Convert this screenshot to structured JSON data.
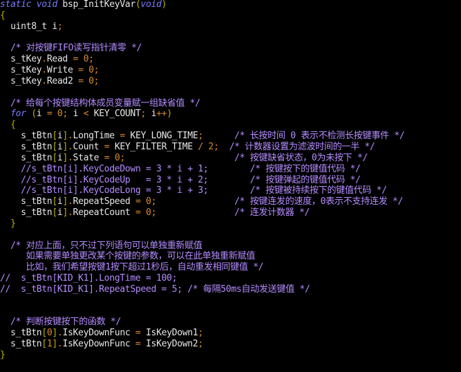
{
  "theme": {
    "background": "#000000",
    "plain": "#e8e8e8",
    "keyword": "#7a7aff",
    "comment": "#b48cff",
    "number": "#d98a2c",
    "operator": "#d98a2c",
    "bracket": "#b9b200",
    "paren": "#b9b200"
  },
  "lines": [
    [
      [
        "keyword",
        "static void "
      ],
      [
        "plain",
        "bsp_InitKeyVar"
      ],
      [
        "paren",
        "("
      ],
      [
        "keyword",
        "void"
      ],
      [
        "paren",
        ")"
      ]
    ],
    [
      [
        "paren",
        "{"
      ]
    ],
    [
      [
        "plain",
        "  uint8_t i"
      ],
      [
        "operator",
        ";"
      ]
    ],
    [],
    [
      [
        "comment",
        "  /* 对按键FIFO读写指针清零 */"
      ]
    ],
    [
      [
        "plain",
        "  s_tKey"
      ],
      [
        "operator",
        "."
      ],
      [
        "plain",
        "Read "
      ],
      [
        "operator",
        "= "
      ],
      [
        "number",
        "0"
      ],
      [
        "operator",
        ";"
      ]
    ],
    [
      [
        "plain",
        "  s_tKey"
      ],
      [
        "operator",
        "."
      ],
      [
        "plain",
        "Write "
      ],
      [
        "operator",
        "= "
      ],
      [
        "number",
        "0"
      ],
      [
        "operator",
        ";"
      ]
    ],
    [
      [
        "plain",
        "  s_tKey"
      ],
      [
        "operator",
        "."
      ],
      [
        "plain",
        "Read2 "
      ],
      [
        "operator",
        "= "
      ],
      [
        "number",
        "0"
      ],
      [
        "operator",
        ";"
      ]
    ],
    [],
    [
      [
        "comment",
        "  /* 给每个按键结构体成员变量赋一组缺省值 */"
      ]
    ],
    [
      [
        "keyword",
        "  for "
      ],
      [
        "paren",
        "("
      ],
      [
        "plain",
        "i "
      ],
      [
        "operator",
        "= "
      ],
      [
        "number",
        "0"
      ],
      [
        "operator",
        "; "
      ],
      [
        "plain",
        "i "
      ],
      [
        "operator",
        "< "
      ],
      [
        "plain",
        "KEY_COUNT"
      ],
      [
        "operator",
        "; "
      ],
      [
        "plain",
        "i"
      ],
      [
        "operator",
        "++"
      ],
      [
        "paren",
        ")"
      ]
    ],
    [
      [
        "paren",
        "  {"
      ]
    ],
    [
      [
        "plain",
        "    s_tBtn"
      ],
      [
        "bracket",
        "["
      ],
      [
        "plain",
        "i"
      ],
      [
        "bracket",
        "]"
      ],
      [
        "operator",
        "."
      ],
      [
        "plain",
        "LongTime "
      ],
      [
        "operator",
        "= "
      ],
      [
        "plain",
        "KEY_LONG_TIME"
      ],
      [
        "operator",
        ";      "
      ],
      [
        "comment",
        "/* 长按时间 0 表示不检测长按键事件 */"
      ]
    ],
    [
      [
        "plain",
        "    s_tBtn"
      ],
      [
        "bracket",
        "["
      ],
      [
        "plain",
        "i"
      ],
      [
        "bracket",
        "]"
      ],
      [
        "operator",
        "."
      ],
      [
        "plain",
        "Count "
      ],
      [
        "operator",
        "= "
      ],
      [
        "plain",
        "KEY_FILTER_TIME "
      ],
      [
        "operator",
        "/ "
      ],
      [
        "number",
        "2"
      ],
      [
        "operator",
        ";  "
      ],
      [
        "comment",
        "/* 计数器设置为滤波时间的一半 */"
      ]
    ],
    [
      [
        "plain",
        "    s_tBtn"
      ],
      [
        "bracket",
        "["
      ],
      [
        "plain",
        "i"
      ],
      [
        "bracket",
        "]"
      ],
      [
        "operator",
        "."
      ],
      [
        "plain",
        "State "
      ],
      [
        "operator",
        "= "
      ],
      [
        "number",
        "0"
      ],
      [
        "operator",
        ";                     "
      ],
      [
        "comment",
        "/* 按键缺省状态，0为未按下 */"
      ]
    ],
    [
      [
        "comment",
        "    //s_tBtn[i].KeyCodeDown = 3 * i + 1;        /* 按键按下的键值代码 */"
      ]
    ],
    [
      [
        "comment",
        "    //s_tBtn[i].KeyCodeUp   = 3 * i + 2;        /* 按键弹起的键值代码 */"
      ]
    ],
    [
      [
        "comment",
        "    //s_tBtn[i].KeyCodeLong = 3 * i + 3;        /* 按键被持续按下的键值代码 */"
      ]
    ],
    [
      [
        "plain",
        "    s_tBtn"
      ],
      [
        "bracket",
        "["
      ],
      [
        "plain",
        "i"
      ],
      [
        "bracket",
        "]"
      ],
      [
        "operator",
        "."
      ],
      [
        "plain",
        "RepeatSpeed "
      ],
      [
        "operator",
        "= "
      ],
      [
        "number",
        "0"
      ],
      [
        "operator",
        ";               "
      ],
      [
        "comment",
        "/* 按键连发的速度，0表示不支持连发 */"
      ]
    ],
    [
      [
        "plain",
        "    s_tBtn"
      ],
      [
        "bracket",
        "["
      ],
      [
        "plain",
        "i"
      ],
      [
        "bracket",
        "]"
      ],
      [
        "operator",
        "."
      ],
      [
        "plain",
        "RepeatCount "
      ],
      [
        "operator",
        "= "
      ],
      [
        "number",
        "0"
      ],
      [
        "operator",
        ";               "
      ],
      [
        "comment",
        "/* 连发计数器 */"
      ]
    ],
    [
      [
        "paren",
        "  }"
      ]
    ],
    [],
    [
      [
        "comment",
        "  /* 对应上面，只不过下列语句可以单独重新赋值"
      ]
    ],
    [
      [
        "comment",
        "     如果需要单独更改某个按键的参数，可以在此单独重新赋值"
      ]
    ],
    [
      [
        "comment",
        "     比如，我们希望按键1按下超过1秒后，自动重发相同键值 */"
      ]
    ],
    [
      [
        "comment",
        "//  s_tBtn[KID_K1].LongTime = 100;"
      ]
    ],
    [
      [
        "comment",
        "//  s_tBtn[KID_K1].RepeatSpeed = 5; /* 每隔50ms自动发送键值 */"
      ]
    ],
    [],
    [],
    [
      [
        "comment",
        "  /* 判断按键按下的函数 */"
      ]
    ],
    [
      [
        "plain",
        "  s_tBtn"
      ],
      [
        "bracket",
        "["
      ],
      [
        "number",
        "0"
      ],
      [
        "bracket",
        "]"
      ],
      [
        "operator",
        "."
      ],
      [
        "plain",
        "IsKeyDownFunc "
      ],
      [
        "operator",
        "= "
      ],
      [
        "plain",
        "IsKeyDown1"
      ],
      [
        "operator",
        ";"
      ]
    ],
    [
      [
        "plain",
        "  s_tBtn"
      ],
      [
        "bracket",
        "["
      ],
      [
        "number",
        "1"
      ],
      [
        "bracket",
        "]"
      ],
      [
        "operator",
        "."
      ],
      [
        "plain",
        "IsKeyDownFunc "
      ],
      [
        "operator",
        "= "
      ],
      [
        "plain",
        "IsKeyDown2"
      ],
      [
        "operator",
        ";"
      ]
    ],
    [
      [
        "paren",
        "}"
      ]
    ]
  ]
}
